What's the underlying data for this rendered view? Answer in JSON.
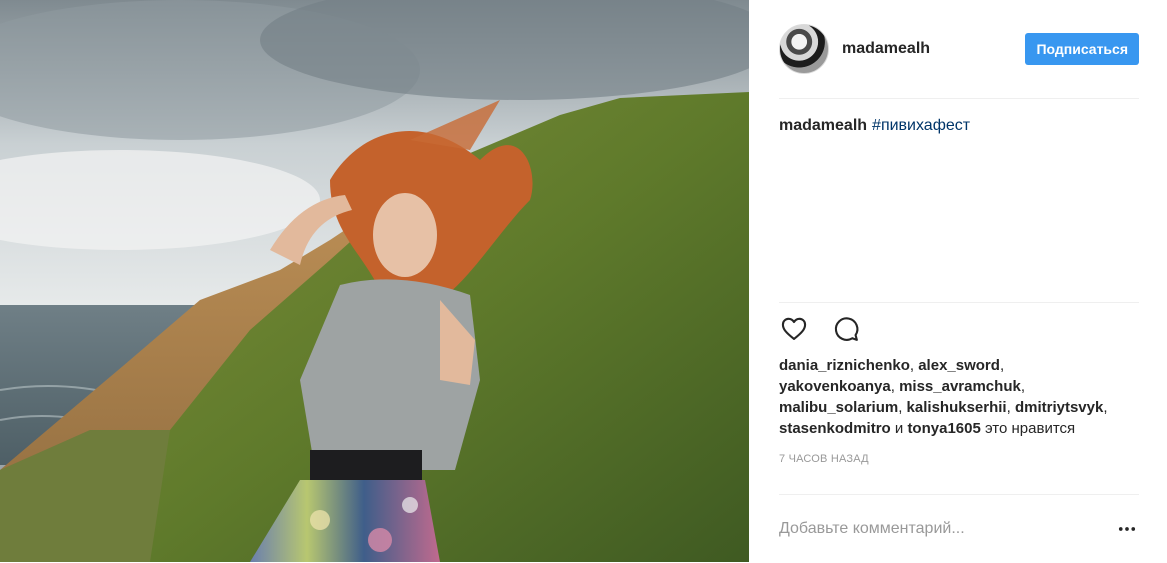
{
  "post": {
    "photo_alt": "фото"
  },
  "header": {
    "username": "madamealh",
    "follow_label": "Подписаться"
  },
  "caption": {
    "username": "madamealh",
    "hashtag": "#пивихафест"
  },
  "actions": {
    "like_icon": "heart-icon",
    "comment_icon": "speech-bubble-icon"
  },
  "likes": {
    "users": [
      "dania_riznichenko",
      "alex_sword",
      "yakovenkoanya",
      "miss_avramchuk",
      "malibu_solarium",
      "kalishukserhii",
      "dmitriytsvyk",
      "stasenkodmitro"
    ],
    "and_word": "и",
    "last_user": "tonya1605",
    "suffix": "это нравится"
  },
  "timestamp": "7 часов назад",
  "comment": {
    "placeholder": "Добавьте комментарий..."
  },
  "colors": {
    "follow_button": "#3897f0",
    "hashtag": "#003569",
    "muted": "#999999"
  }
}
